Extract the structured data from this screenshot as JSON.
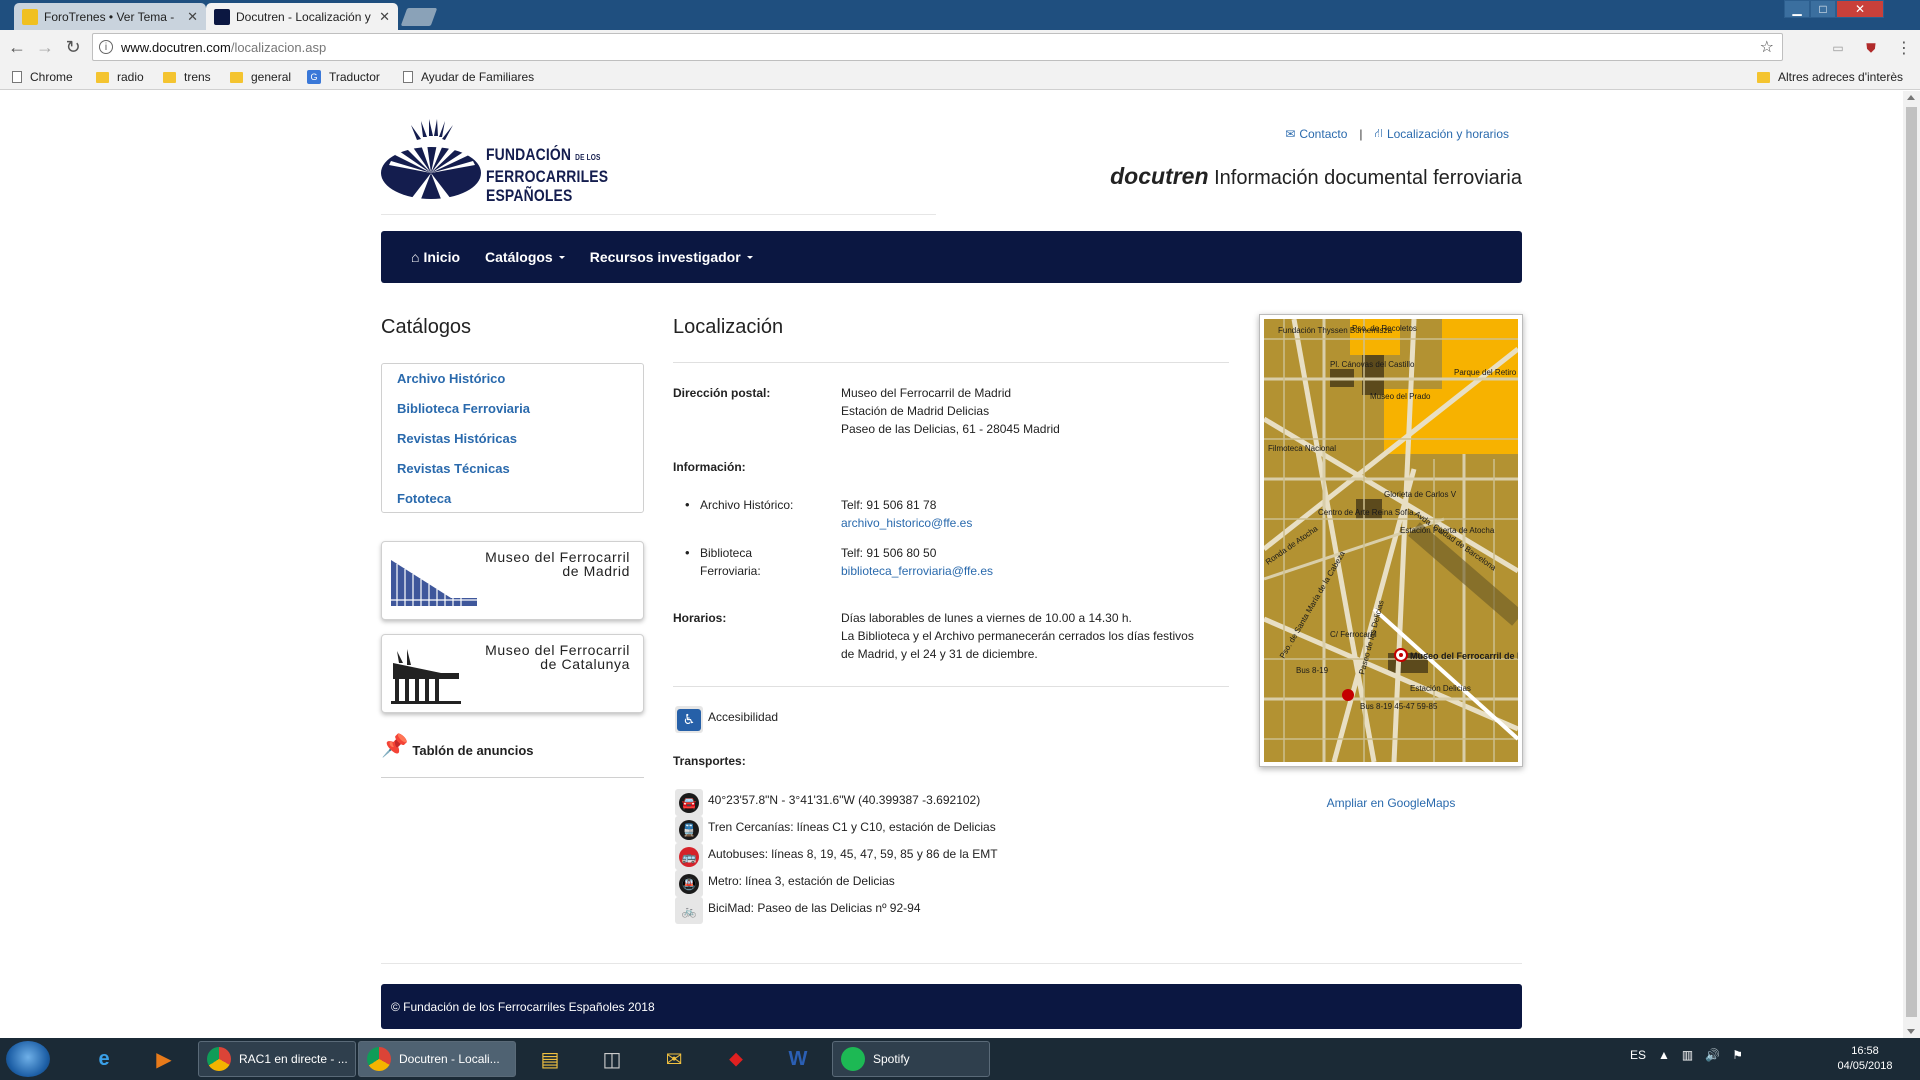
{
  "browser": {
    "tabs": [
      {
        "title": "ForoTrenes • Ver Tema - ",
        "close": "✕"
      },
      {
        "title": "Docutren - Localización y",
        "close": "✕"
      }
    ],
    "url_host": "www.docutren.com",
    "url_path": "/localizacion.asp",
    "bookmarks": [
      {
        "label": "Chrome",
        "kind": "page"
      },
      {
        "label": "radio",
        "kind": "folder"
      },
      {
        "label": "trens",
        "kind": "folder"
      },
      {
        "label": "general",
        "kind": "folder"
      },
      {
        "label": "Traductor",
        "kind": "translate"
      },
      {
        "label": "Ayudar de Familiares",
        "kind": "page"
      },
      {
        "label": "Altres adreces d'interès",
        "kind": "folder"
      }
    ]
  },
  "header": {
    "logo_line1": "FUNDACIÓN",
    "logo_line1_small": "DE LOS",
    "logo_line2": "FERROCARRILES",
    "logo_line3": "ESPAÑOLES",
    "contact": "Contacto",
    "separator": "|",
    "location": "Localización y horarios",
    "brand": "docutren",
    "tagline": "Información documental ferroviaria"
  },
  "nav": {
    "home": "Inicio",
    "catalogs": "Catálogos",
    "resources": "Recursos investigador"
  },
  "sidebar": {
    "title": "Catálogos",
    "items": [
      "Archivo Histórico",
      "Biblioteca Ferroviaria",
      "Revistas Históricas",
      "Revistas Técnicas",
      "Fototeca"
    ],
    "museum1": "Museo del Ferrocarril\nde Madrid",
    "museum2": "Museo del Ferrocarril\nde Catalunya",
    "notice": "Tablón de anuncios"
  },
  "main": {
    "title": "Localización",
    "postal_label": "Dirección postal:",
    "postal_lines": [
      "Museo del Ferrocarril de Madrid",
      "Estación de Madrid Delicias",
      "Paseo de las Delicias, 61 - 28045 Madrid"
    ],
    "info_label": "Información:",
    "archive_label": "Archivo Histórico:",
    "archive_phone": "Telf: 91 506 81 78",
    "archive_email": "archivo_historico@ffe.es",
    "library_label_1": "Biblioteca",
    "library_label_2": "Ferroviaria:",
    "library_phone": "Telf: 91 506 80 50",
    "library_email": "biblioteca_ferroviaria@ffe.es",
    "hours_label": "Horarios:",
    "hours_lines": [
      "Días laborables de lunes a viernes de 10.00 a 14.30 h.",
      "La Biblioteca y el Archivo permanecerán cerrados los días festivos",
      "de Madrid, y el 24 y 31 de diciembre."
    ],
    "accessibility": "Accesibilidad",
    "transport_label": "Transportes:",
    "transports": [
      "40°23'57.8\"N - 3°41'31.6\"W (40.399387 -3.692102)",
      "Tren Cercanías: líneas C1 y C10, estación de Delicias",
      "Autobuses: líneas 8, 19, 45, 47, 59, 85 y 86 de la EMT",
      "Metro: línea 3, estación de Delicias",
      "BiciMad: Paseo de las Delicias nº 92-94"
    ]
  },
  "map": {
    "labels": [
      "Fundación Thyssen Bornemisza",
      "Pso. de Recoletos",
      "Pl. Cánovas del Castillo",
      "Museo del Prado",
      "Parque del Retiro",
      "Filmoteca Nacional",
      "Glorieta de Carlos V",
      "Centro de Arte Reina Sofía",
      "Estación Puerta de Atocha",
      "Ronda de Atocha",
      "Museo del Ferrocarril de Madrid",
      "Estación Delicias",
      "Avda. Ciudad de Barcelona",
      "Pso. de Santa María de la Cabeza",
      "Paseo de las Delicias",
      "C/ Ferrocarril",
      "Bus 8-19",
      "Bus 8-19 45-47 59-85"
    ],
    "link": "Ampliar en GoogleMaps"
  },
  "footer": {
    "text": "© Fundación de los Ferrocarriles Españoles 2018"
  },
  "taskbar": {
    "tasks": [
      "RAC1 en directe - ...",
      "Docutren - Locali...",
      "Spotify"
    ],
    "lang": "ES",
    "time": "16:58",
    "date": "04/05/2018"
  },
  "colors": {
    "navy": "#0b1741",
    "link": "#2a6aad",
    "map_ground": "#b39232",
    "map_highlight": "#f7b200"
  }
}
